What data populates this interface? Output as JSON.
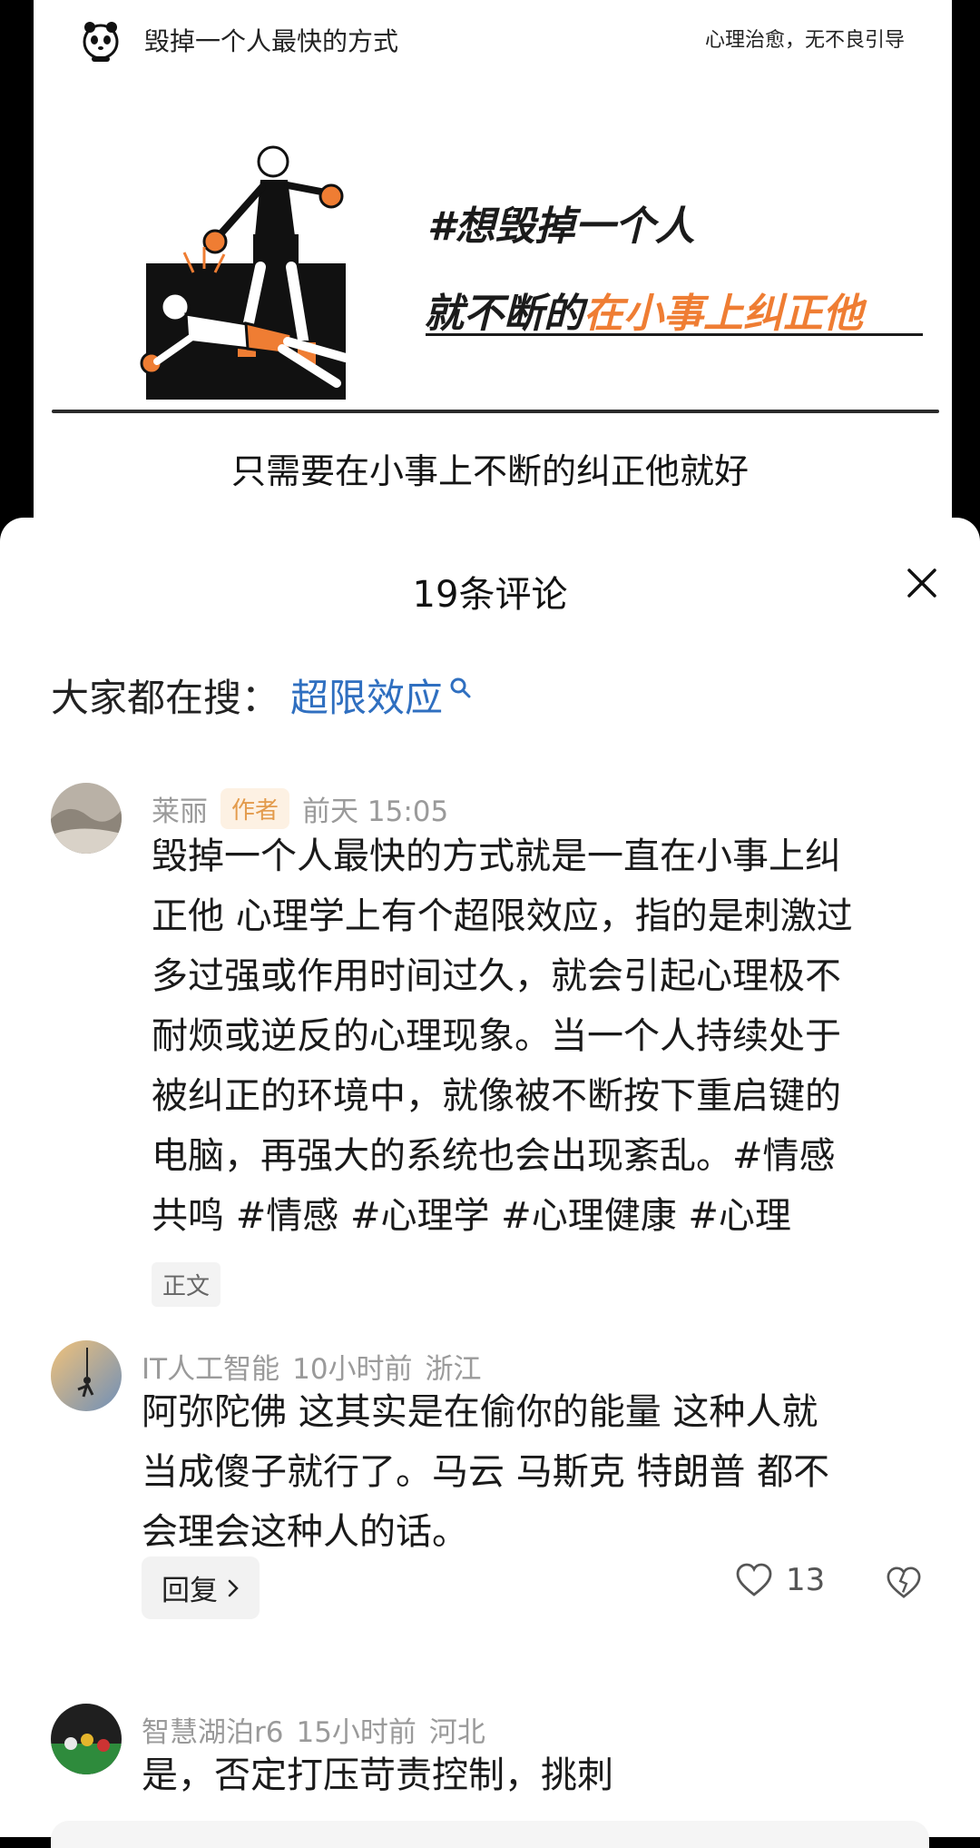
{
  "video": {
    "brand_title": "毁掉一个人最快的方式",
    "top_right": "心理治愈，无不良引导",
    "headline1": "#想毁掉一个人",
    "headline2_black": "就不断的",
    "headline2_orange": "在小事上纠正他",
    "subtitle": "只需要在小事上不断的纠正他就好",
    "accent_color": "#ef7d33"
  },
  "sheet": {
    "title": "19条评论",
    "close_icon": "close-icon",
    "hot_search_label": "大家都在搜：",
    "hot_search_term": "超限效应",
    "link_color": "#2f6fc0"
  },
  "comments": [
    {
      "user": "莱丽",
      "badge": "作者",
      "time": "前天 15:05",
      "location": "",
      "lines": [
        "毁掉一个人最快的方式就是一直在小事上纠",
        "正他 心理学上有个超限效应，指的是刺激过",
        "多过强或作用时间过久，就会引起心理极不",
        "耐烦或逆反的心理现象。当一个人持续处于",
        "被纠正的环境中，就像被不断按下重启键的",
        "电脑，再强大的系统也会出现紊乱。#情感",
        "共鸣 #情感  #心理学 #心理健康 #心理"
      ],
      "chip": "正文"
    },
    {
      "user": "IT人工智能",
      "time": "10小时前",
      "location": "浙江",
      "lines": [
        "阿弥陀佛 这其实是在偷你的能量 这种人就",
        "当成傻子就行了。马云 马斯克 特朗普 都不",
        "会理会这种人的话。"
      ],
      "reply_label": "回复",
      "likes": "13"
    },
    {
      "user": "智慧湖泊r6",
      "time": "15小时前",
      "location": "河北",
      "lines": [
        "是，否定打压苛责控制，挑刺"
      ]
    }
  ]
}
